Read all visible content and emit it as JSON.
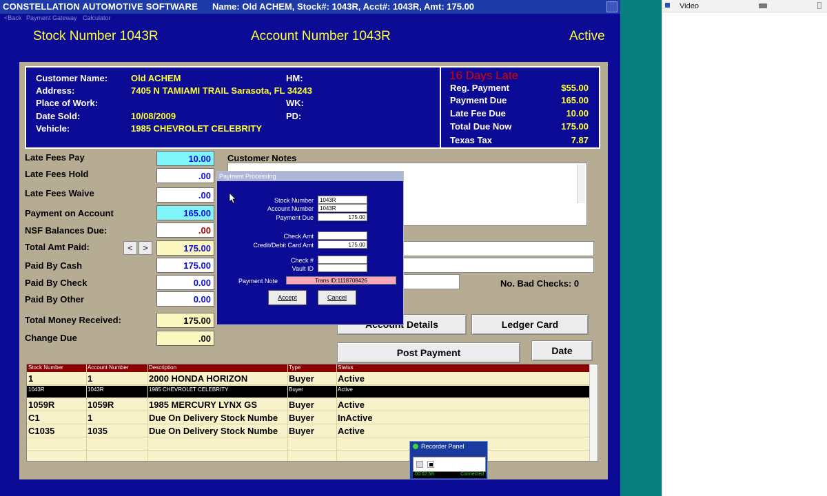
{
  "window": {
    "app_name": "CONSTELLATION AUTOMOTIVE SOFTWARE",
    "title": "Name: Old ACHEM, Stock#: 1043R, Acct#: 1043R, Amt: 175.00",
    "menu": [
      "<Back",
      "Payment Gateway",
      "Calculator"
    ]
  },
  "header": {
    "stock_label": "Stock Number 1043R",
    "account_label": "Account Number 1043R",
    "status": "Active"
  },
  "customer": {
    "name_label": "Customer Name:",
    "name": "Old ACHEM",
    "address_label": "Address:",
    "address": "7405 N TAMIAMI TRAIL Sarasota, FL 34243",
    "work_label": "Place of Work:",
    "work": "",
    "sold_label": "Date Sold:",
    "sold": "10/08/2009",
    "vehicle_label": "Vehicle:",
    "vehicle": "1985 CHEVROLET CELEBRITY",
    "hm_label": "HM:",
    "wk_label": "WK:",
    "pd_label": "PD:"
  },
  "summary": {
    "late_banner": "16 Days Late",
    "rows": [
      {
        "label": "Reg. Payment",
        "value": "$55.00"
      },
      {
        "label": "Payment Due",
        "value": "165.00"
      },
      {
        "label": "Late Fee Due",
        "value": "10.00"
      },
      {
        "label": "Total Due Now",
        "value": "175.00"
      },
      {
        "label": "Texas Tax",
        "value": "7.87"
      }
    ]
  },
  "payment": {
    "late_fees_pay_label": "Late Fees Pay",
    "late_fees_pay": "10.00",
    "late_fees_hold_label": "Late Fees Hold",
    "late_fees_hold": ".00",
    "late_fees_waive_label": "Late Fees Waive",
    "late_fees_waive": ".00",
    "payment_on_account_label": "Payment on Account",
    "payment_on_account": "165.00",
    "nsf_label": "NSF Balances Due:",
    "nsf": ".00",
    "total_paid_label": "Total Amt Paid:",
    "total_paid": "175.00",
    "prev_btn": "<",
    "next_btn": ">",
    "cash_label": "Paid By Cash",
    "cash": "175.00",
    "check_label": "Paid By Check",
    "check": "0.00",
    "other_label": "Paid By Other",
    "other": "0.00",
    "received_label": "Total Money Received:",
    "received": "175.00",
    "change_label": "Change Due",
    "change": ".00"
  },
  "notes": {
    "label": "Customer Notes",
    "bad_checks": "No. Bad Checks: 0"
  },
  "actions": {
    "account_details": "Account Details",
    "ledger_card": "Ledger Card",
    "post_payment": "Post Payment",
    "date": "Date"
  },
  "dialog": {
    "title": "Payment Processing",
    "stock_label": "Stock Number",
    "stock": "1043R",
    "account_label": "Account Number",
    "account": "1043R",
    "due_label": "Payment Due",
    "due": "175.00",
    "check_amt_label": "Check Amt",
    "check_amt": "",
    "card_amt_label": "Credit/Debit Card Amt",
    "card_amt": "175.00",
    "check_no_label": "Check #",
    "check_no": "",
    "vault_label": "Vault ID",
    "vault": "",
    "note_label": "Payment Note",
    "note": "Trans ID:1118708426",
    "accept": "Accept",
    "cancel": "Cancel"
  },
  "table": {
    "columns": [
      "Stock Number",
      "Account Number",
      "Description",
      "Type",
      "Status"
    ],
    "rows": [
      {
        "stock": "1",
        "account": "1",
        "desc": "2000 HONDA HORIZON",
        "type": "Buyer",
        "status": "Active"
      },
      {
        "stock": "1043R",
        "account": "1043R",
        "desc": "1985 CHEVROLET CELEBRITY",
        "type": "Buyer",
        "status": "Active"
      },
      {
        "stock": "1059R",
        "account": "1059R",
        "desc": "1985 MERCURY LYNX GS",
        "type": "Buyer",
        "status": "Active"
      },
      {
        "stock": "C1",
        "account": "1",
        "desc": "Due On Delivery Stock Numbe",
        "type": "Buyer",
        "status": "InActive"
      },
      {
        "stock": "C1035",
        "account": "1035",
        "desc": "Due On Delivery Stock Numbe",
        "type": "Buyer",
        "status": "Active"
      }
    ]
  },
  "recorder": {
    "title": "Recorder Panel",
    "time": "00:02:58",
    "state": "Connected"
  },
  "side_panel": {
    "title": "Video"
  },
  "colors": {
    "app_bg": "#0b0b95",
    "frame": "#b5ac93",
    "accent_yellow": "#ffff33",
    "late_red": "#e00000",
    "grid_header": "#8b0000"
  }
}
